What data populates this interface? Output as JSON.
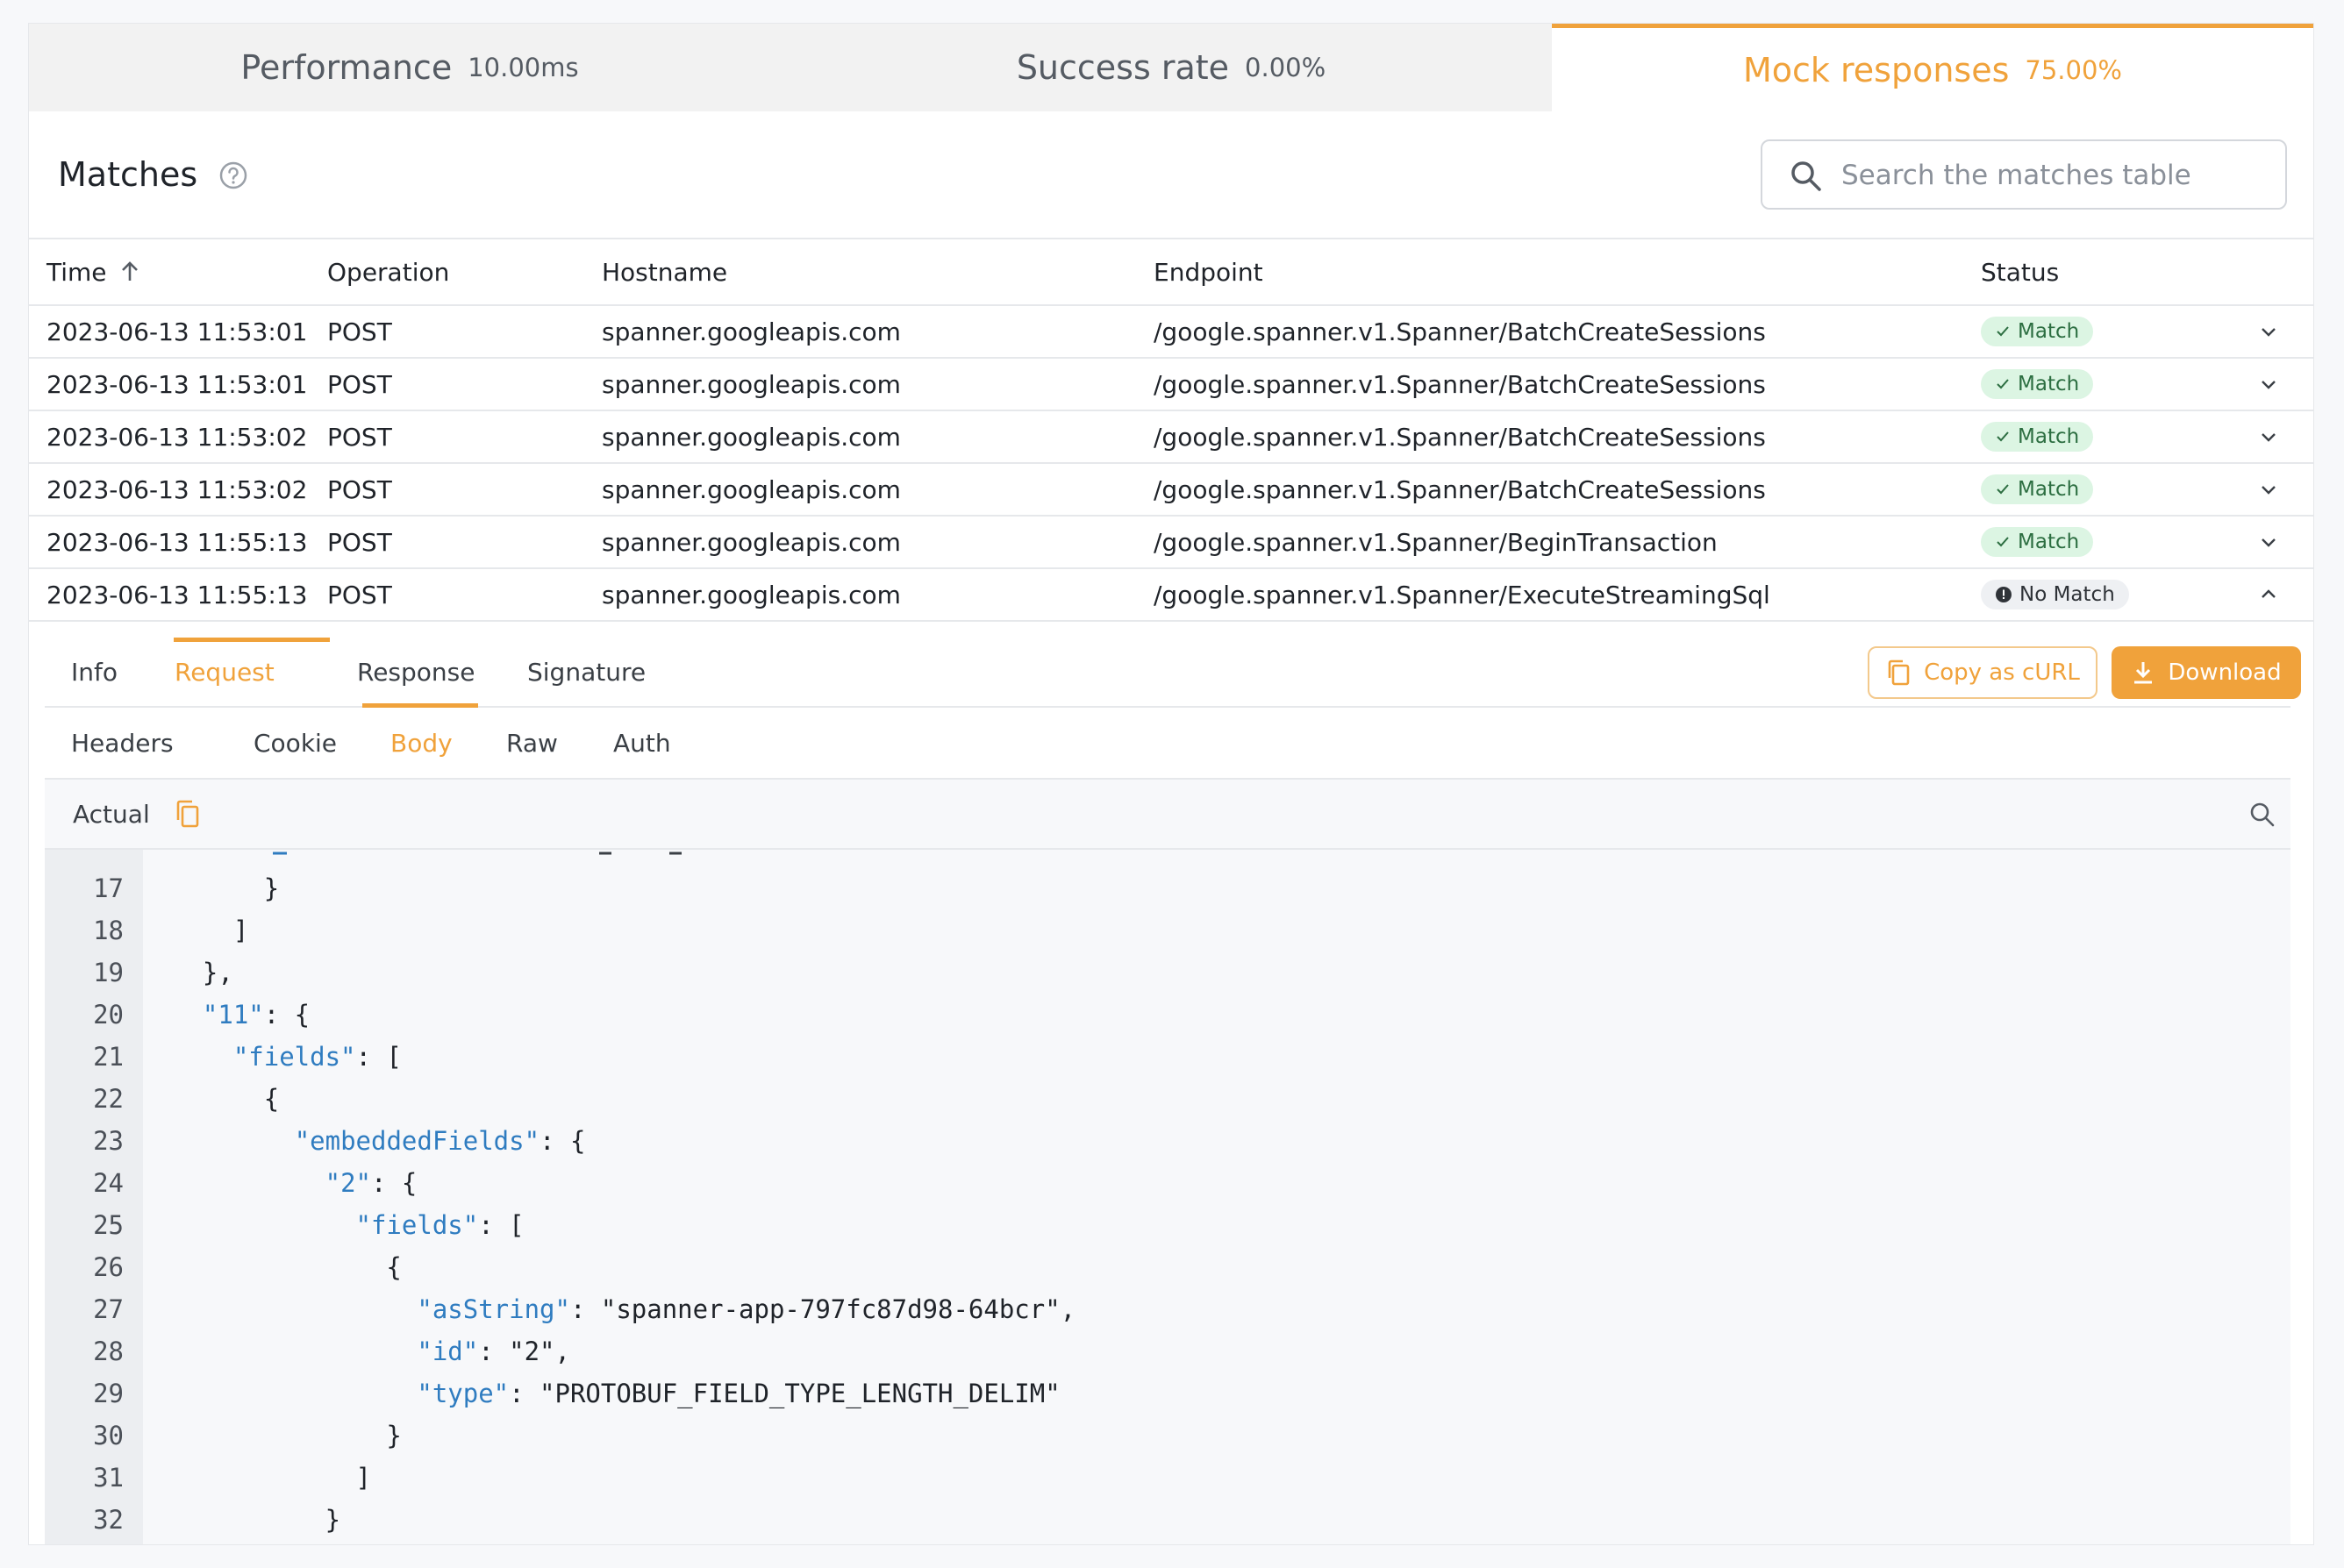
{
  "metrics": [
    {
      "label": "Performance",
      "value": "10.00ms",
      "active": false
    },
    {
      "label": "Success rate",
      "value": "0.00%",
      "active": false
    },
    {
      "label": "Mock responses",
      "value": "75.00%",
      "active": true
    }
  ],
  "matches": {
    "title": "Matches",
    "search_placeholder": "Search the matches table",
    "columns": [
      "Time",
      "Operation",
      "Hostname",
      "Endpoint",
      "Status"
    ],
    "rows": [
      {
        "time": "2023-06-13 11:53:01",
        "operation": "POST",
        "hostname": "spanner.googleapis.com",
        "endpoint": "/google.spanner.v1.Spanner/BatchCreateSessions",
        "status": "Match"
      },
      {
        "time": "2023-06-13 11:53:01",
        "operation": "POST",
        "hostname": "spanner.googleapis.com",
        "endpoint": "/google.spanner.v1.Spanner/BatchCreateSessions",
        "status": "Match"
      },
      {
        "time": "2023-06-13 11:53:02",
        "operation": "POST",
        "hostname": "spanner.googleapis.com",
        "endpoint": "/google.spanner.v1.Spanner/BatchCreateSessions",
        "status": "Match"
      },
      {
        "time": "2023-06-13 11:53:02",
        "operation": "POST",
        "hostname": "spanner.googleapis.com",
        "endpoint": "/google.spanner.v1.Spanner/BatchCreateSessions",
        "status": "Match"
      },
      {
        "time": "2023-06-13 11:55:13",
        "operation": "POST",
        "hostname": "spanner.googleapis.com",
        "endpoint": "/google.spanner.v1.Spanner/BeginTransaction",
        "status": "Match"
      },
      {
        "time": "2023-06-13 11:55:13",
        "operation": "POST",
        "hostname": "spanner.googleapis.com",
        "endpoint": "/google.spanner.v1.Spanner/ExecuteStreamingSql",
        "status": "No Match"
      }
    ]
  },
  "detail": {
    "tabs": [
      "Info",
      "Request",
      "Response",
      "Signature"
    ],
    "active_tab": "Request",
    "copy_curl_label": "Copy as cURL",
    "download_label": "Download",
    "sub_tabs": [
      "Headers",
      "Cookie",
      "Body",
      "Raw",
      "Auth"
    ],
    "active_sub_tab": "Body",
    "actual_label": "Actual"
  },
  "code_lines": [
    {
      "n": "17",
      "pre": "      }",
      "key": "",
      "post": ""
    },
    {
      "n": "18",
      "pre": "    ]",
      "key": "",
      "post": ""
    },
    {
      "n": "19",
      "pre": "  },",
      "key": "",
      "post": ""
    },
    {
      "n": "20",
      "pre": "  ",
      "key": "\"11\"",
      "post": ": {"
    },
    {
      "n": "21",
      "pre": "    ",
      "key": "\"fields\"",
      "post": ": ["
    },
    {
      "n": "22",
      "pre": "      {",
      "key": "",
      "post": ""
    },
    {
      "n": "23",
      "pre": "        ",
      "key": "\"embeddedFields\"",
      "post": ": {"
    },
    {
      "n": "24",
      "pre": "          ",
      "key": "\"2\"",
      "post": ": {"
    },
    {
      "n": "25",
      "pre": "            ",
      "key": "\"fields\"",
      "post": ": ["
    },
    {
      "n": "26",
      "pre": "              {",
      "key": "",
      "post": ""
    },
    {
      "n": "27",
      "pre": "                ",
      "key": "\"asString\"",
      "post": ": \"spanner-app-797fc87d98-64bcr\","
    },
    {
      "n": "28",
      "pre": "                ",
      "key": "\"id\"",
      "post": ": \"2\","
    },
    {
      "n": "29",
      "pre": "                ",
      "key": "\"type\"",
      "post": ": \"PROTOBUF_FIELD_TYPE_LENGTH_DELIM\""
    },
    {
      "n": "30",
      "pre": "              }",
      "key": "",
      "post": ""
    },
    {
      "n": "31",
      "pre": "            ]",
      "key": "",
      "post": ""
    },
    {
      "n": "32",
      "pre": "          }",
      "key": "",
      "post": ""
    }
  ],
  "colors": {
    "accent": "#f0a23b",
    "match_bg": "#dcf5e3",
    "match_text": "#2c6e41",
    "json_key": "#2f7cc0"
  }
}
